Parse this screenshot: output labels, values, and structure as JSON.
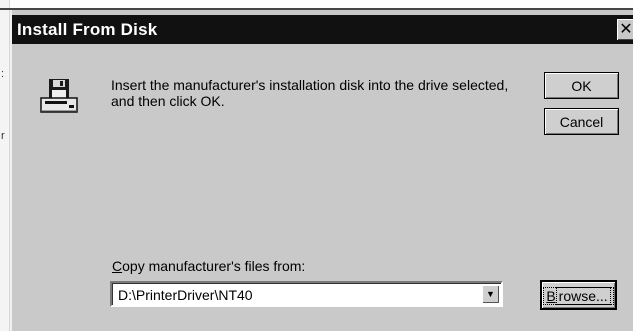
{
  "background": {
    "fragments": [
      ":",
      "r"
    ]
  },
  "dialog": {
    "title": "Install From Disk",
    "close_glyph": "✕",
    "message": "Insert the manufacturer's installation disk into the drive selected, and then click OK.",
    "ok_label": "OK",
    "cancel_label": "Cancel",
    "copy_label_access": "C",
    "copy_label_rest": "opy manufacturer's files from:",
    "path_value": "D:\\PrinterDriver\\NT40",
    "combo_arrow": "▼",
    "browse_access": "B",
    "browse_rest": "rowse..."
  },
  "icons": {
    "disk": "floppy-disk-drive-icon"
  },
  "colors": {
    "titlebar": "#111111",
    "dialog_face": "#c9c9c9"
  }
}
